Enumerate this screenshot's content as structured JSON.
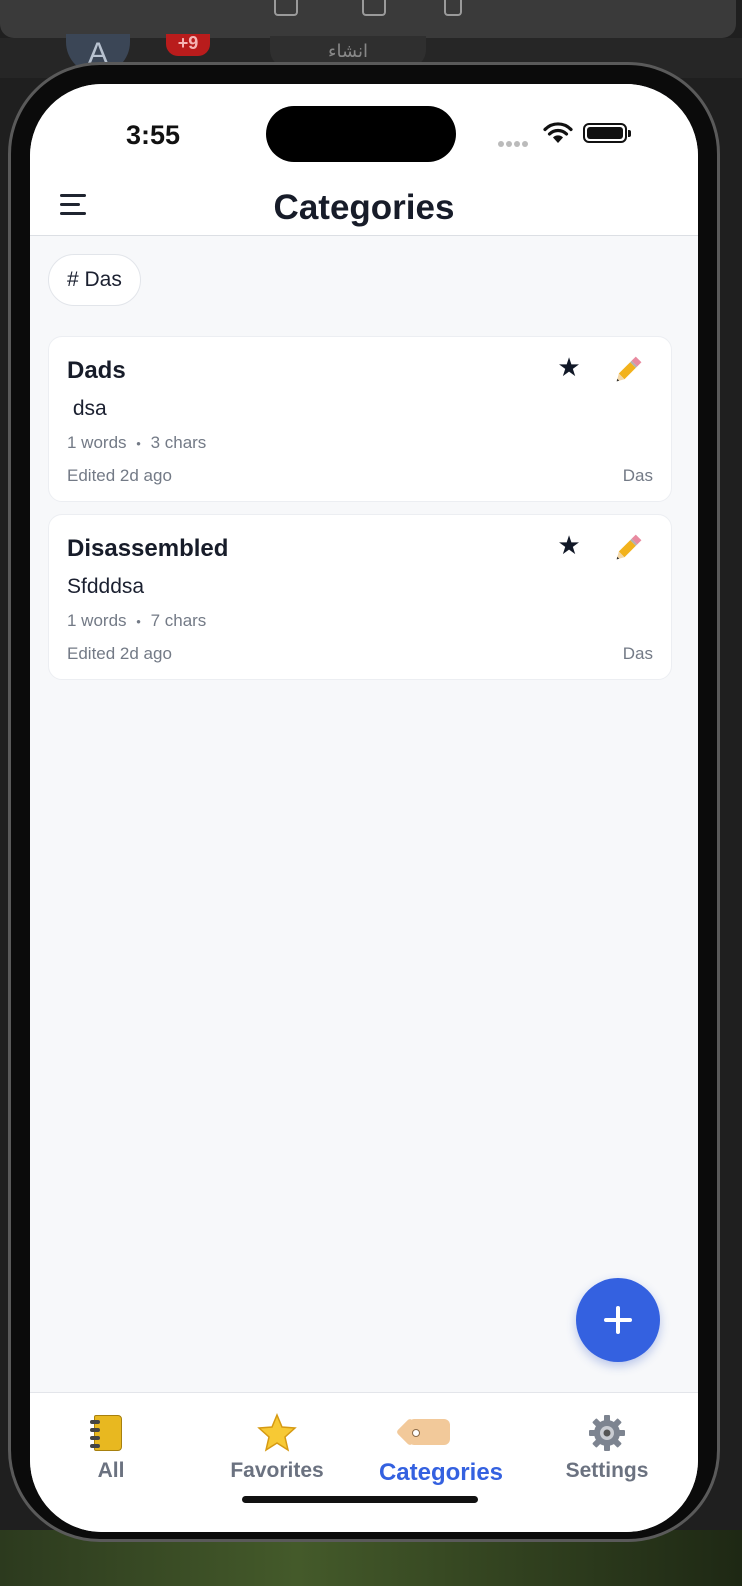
{
  "background": {
    "avatar_letter": "A",
    "badge_text": "+9",
    "create_label": "انشاء"
  },
  "status_bar": {
    "time": "3:55"
  },
  "header": {
    "title": "Categories"
  },
  "filter_chip": {
    "label": "# Das"
  },
  "notes": [
    {
      "title": "Dads",
      "body": " dsa",
      "words": "1 words",
      "chars": "3 chars",
      "separator": "•",
      "edited": "Edited 2d ago",
      "category": "Das"
    },
    {
      "title": "Disassembled",
      "body": "Sfdddsa",
      "words": "1 words",
      "chars": "7 chars",
      "separator": "•",
      "edited": "Edited 2d ago",
      "category": "Das"
    }
  ],
  "tabs": [
    {
      "label": "All",
      "icon": "notebook-icon"
    },
    {
      "label": "Favorites",
      "icon": "star-icon"
    },
    {
      "label": "Categories",
      "icon": "tag-icon"
    },
    {
      "label": "Settings",
      "icon": "gear-icon"
    }
  ],
  "active_tab": "Categories",
  "colors": {
    "accent": "#3461e0",
    "title": "#171c29",
    "muted": "#737a86",
    "background": "#f7f8fa"
  }
}
